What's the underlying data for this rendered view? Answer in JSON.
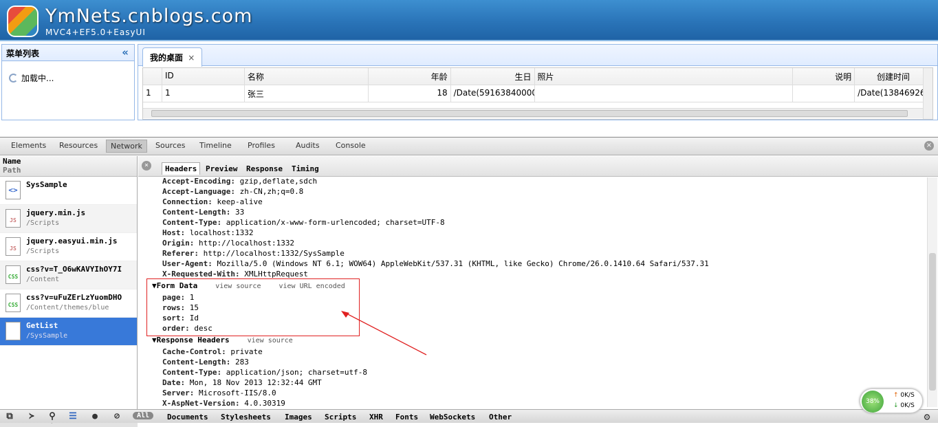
{
  "banner": {
    "title": "YmNets.cnblogs.com",
    "subtitle": "MVC4+EF5.0+EasyUI"
  },
  "menu": {
    "title": "菜单列表",
    "loading": "加载中..."
  },
  "tabs": {
    "desktop": "我的桌面",
    "close": "×"
  },
  "grid": {
    "headers": [
      "",
      "ID",
      "名称",
      "年龄",
      "生日",
      "照片",
      "说明",
      "创建时间"
    ],
    "rows": [
      [
        "1",
        "1",
        "张三",
        "18",
        "/Date(591638400000",
        "",
        "",
        "/Date(13846926"
      ]
    ]
  },
  "devtools": {
    "tabs": [
      "Elements",
      "Resources",
      "Network",
      "Sources",
      "Timeline",
      "Profiles",
      "Audits",
      "Console"
    ],
    "list_header": {
      "name": "Name",
      "path": "Path"
    },
    "requests": [
      {
        "name": "SysSample",
        "path": ""
      },
      {
        "name": "jquery.min.js",
        "path": "/Scripts"
      },
      {
        "name": "jquery.easyui.min.js",
        "path": "/Scripts"
      },
      {
        "name": "css?v=T_O6wKAVYIhOY7I",
        "path": "/Content"
      },
      {
        "name": "css?v=uFuZErLzYuomDHO",
        "path": "/Content/themes/blue"
      },
      {
        "name": "GetList",
        "path": "/SysSample"
      }
    ],
    "request_count": "6 requests  |  2.0 KB trans",
    "detail_tabs": [
      "Headers",
      "Preview",
      "Response",
      "Timing"
    ],
    "request_headers": [
      [
        "Accept-Encoding:",
        "gzip,deflate,sdch"
      ],
      [
        "Accept-Language:",
        "zh-CN,zh;q=0.8"
      ],
      [
        "Connection:",
        "keep-alive"
      ],
      [
        "Content-Length:",
        "33"
      ],
      [
        "Content-Type:",
        "application/x-www-form-urlencoded; charset=UTF-8"
      ],
      [
        "Host:",
        "localhost:1332"
      ],
      [
        "Origin:",
        "http://localhost:1332"
      ],
      [
        "Referer:",
        "http://localhost:1332/SysSample"
      ],
      [
        "User-Agent:",
        "Mozilla/5.0 (Windows NT 6.1; WOW64) AppleWebKit/537.31 (KHTML, like Gecko) Chrome/26.0.1410.64 Safari/537.31"
      ],
      [
        "X-Requested-With:",
        "XMLHttpRequest"
      ]
    ],
    "form_data": {
      "title": "Form Data",
      "view_source": "view source",
      "view_url": "view URL encoded",
      "items": [
        [
          "page:",
          "1"
        ],
        [
          "rows:",
          "15"
        ],
        [
          "sort:",
          "Id"
        ],
        [
          "order:",
          "desc"
        ]
      ]
    },
    "response_headers": {
      "title": "Response Headers",
      "view_source": "view source",
      "items": [
        [
          "Cache-Control:",
          "private"
        ],
        [
          "Content-Length:",
          "283"
        ],
        [
          "Content-Type:",
          "application/json; charset=utf-8"
        ],
        [
          "Date:",
          "Mon, 18 Nov 2013 12:32:44 GMT"
        ],
        [
          "Server:",
          "Microsoft-IIS/8.0"
        ],
        [
          "X-AspNet-Version:",
          "4.0.30319"
        ]
      ]
    },
    "filters": [
      "All",
      "Documents",
      "Stylesheets",
      "Images",
      "Scripts",
      "XHR",
      "Fonts",
      "WebSockets",
      "Other"
    ]
  },
  "speed": {
    "percent": "38%",
    "up": "0K/S",
    "down": "0K/S"
  },
  "colors": {
    "banner": "#2a74b8",
    "selected_row": "#3879d9",
    "highlight_box": "#e02020"
  }
}
